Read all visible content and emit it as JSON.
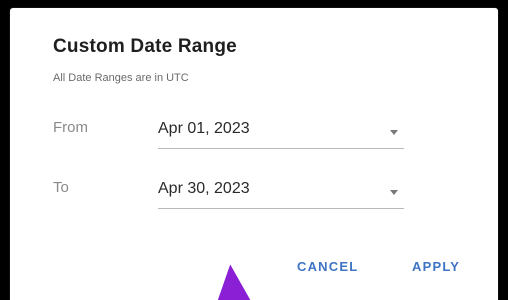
{
  "dialog": {
    "title": "Custom Date Range",
    "subtitle": "All Date Ranges are in UTC",
    "from": {
      "label": "From",
      "value": "Apr 01, 2023"
    },
    "to": {
      "label": "To",
      "value": "Apr 30, 2023"
    },
    "buttons": {
      "cancel": "CANCEL",
      "apply": "APPLY"
    }
  },
  "colors": {
    "accent": "#3f74c4",
    "cursor": "#8b1fd6",
    "background": "#000000",
    "dialog": "#ffffff"
  },
  "icons": {
    "dropdown": "chevron-down-icon",
    "pointer": "mouse-pointer-icon"
  }
}
